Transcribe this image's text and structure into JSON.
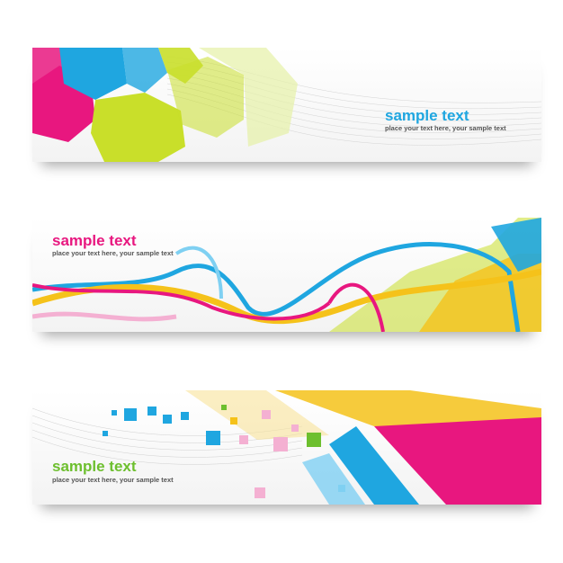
{
  "colors": {
    "blue": "#1fa6e0",
    "pink": "#e8177f",
    "green": "#6dbf2e",
    "lime": "#c9df2a",
    "yellow": "#f5c21a",
    "orange": "#f39a12"
  },
  "banners": [
    {
      "title": "sample text",
      "subtitle": "place your text here, your sample text",
      "title_color": "#1fa6e0"
    },
    {
      "title": "sample text",
      "subtitle": "place your text here, your sample text",
      "title_color": "#e8177f"
    },
    {
      "title": "sample text",
      "subtitle": "place your text here, your sample text",
      "title_color": "#6dbf2e"
    }
  ]
}
